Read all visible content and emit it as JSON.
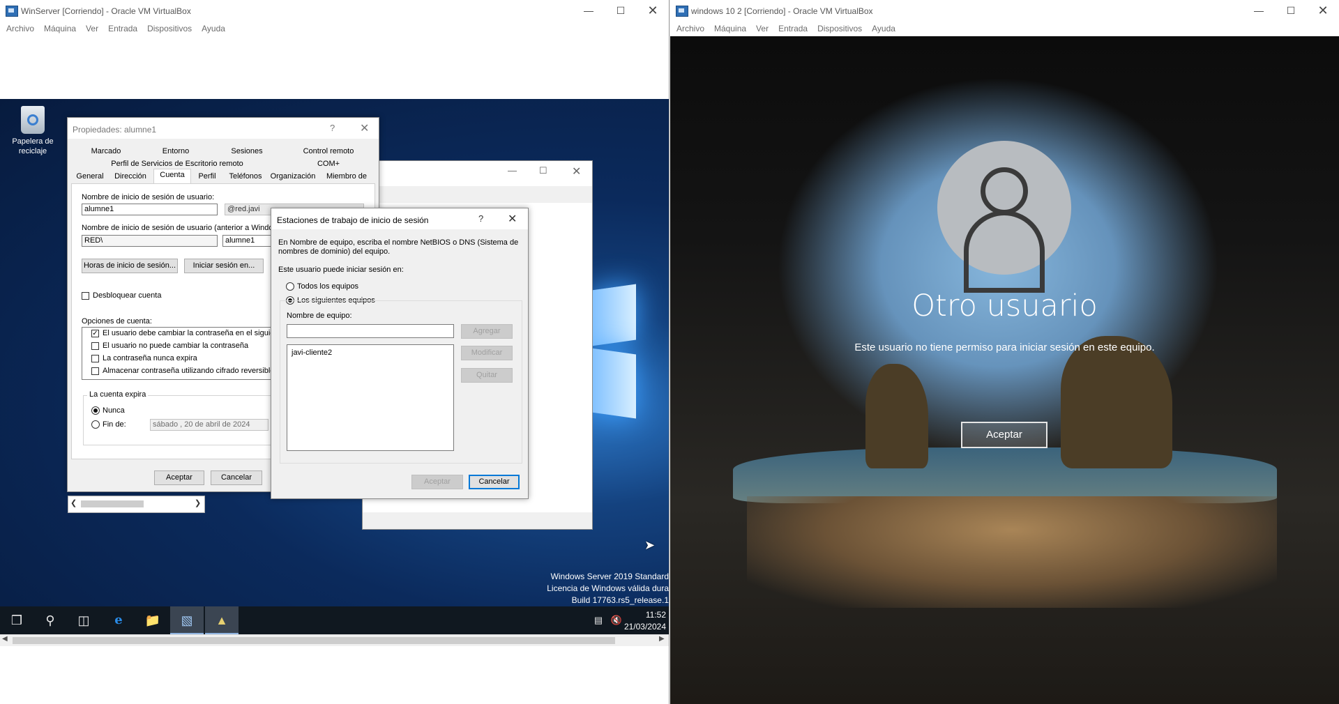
{
  "left_vm": {
    "title": "WinServer [Corriendo] - Oracle VM VirtualBox",
    "menu": [
      "Archivo",
      "Máquina",
      "Ver",
      "Entrada",
      "Dispositivos",
      "Ayuda"
    ],
    "desktop_icon_label": "Papelera de reciclaje",
    "watermark": {
      "line1": "Windows Server 2019 Standard",
      "line2": "Licencia de Windows válida dura",
      "line3": "Build 17763.rs5_release.1"
    },
    "clock": {
      "time": "11:52",
      "date": "21/03/2024"
    }
  },
  "props_dialog": {
    "title": "Propiedades: alumne1",
    "help": "?",
    "tabs_row1": [
      "Marcado",
      "Entorno",
      "Sesiones",
      "Control remoto"
    ],
    "tabs_row2": [
      "Perfil de Servicios de Escritorio remoto",
      "COM+"
    ],
    "tabs_row3": [
      "General",
      "Dirección",
      "Cuenta",
      "Perfil",
      "Teléfonos",
      "Organización",
      "Miembro de"
    ],
    "logon_label": "Nombre de inicio de sesión de usuario:",
    "logon_value": "alumne1",
    "domain_suffix": "@red.javi",
    "pre2000_label": "Nombre de inicio de sesión de usuario (anterior a Windows",
    "pre2000_domain": "RED\\",
    "pre2000_user": "alumne1",
    "logon_hours_button": "Horas de inicio de sesión...",
    "logon_to_button": "Iniciar sesión en...",
    "unlock_label": "Desbloquear cuenta",
    "options_label": "Opciones de cuenta:",
    "options": [
      {
        "label": "El usuario debe cambiar la contraseña en el siguient",
        "checked": true
      },
      {
        "label": "El usuario no puede cambiar la contraseña",
        "checked": false
      },
      {
        "label": "La contraseña nunca expira",
        "checked": false
      },
      {
        "label": "Almacenar contraseña utilizando cifrado reversible",
        "checked": false
      }
    ],
    "expires_label": "La cuenta expira",
    "never_label": "Nunca",
    "end_label": "Fin de:",
    "end_date": "sábado , 20 de      abril      de 2024",
    "ok": "Aceptar",
    "cancel": "Cancelar"
  },
  "workstations_dialog": {
    "title": "Estaciones de trabajo de inicio de sesión",
    "help": "?",
    "intro": "En Nombre de equipo, escriba el nombre NetBIOS o DNS (Sistema de nombres de dominio) del equipo.",
    "can_logon_label": "Este usuario puede iniciar sesión en:",
    "all_label": "Todos los equipos",
    "following_label": "Los siguientes equipos",
    "computer_name_label": "Nombre de equipo:",
    "computer_name_value": "",
    "computers": [
      "javi-cliente2"
    ],
    "add": "Agregar",
    "modify": "Modificar",
    "remove": "Quitar",
    "ok": "Aceptar",
    "cancel": "Cancelar"
  },
  "right_vm": {
    "title": "windows 10 2 [Corriendo] - Oracle VM VirtualBox",
    "menu": [
      "Archivo",
      "Máquina",
      "Ver",
      "Entrada",
      "Dispositivos",
      "Ayuda"
    ],
    "user_name": "Otro usuario",
    "message": "Este usuario no tiene permiso para iniciar sesión en este equipo.",
    "accept": "Aceptar"
  }
}
